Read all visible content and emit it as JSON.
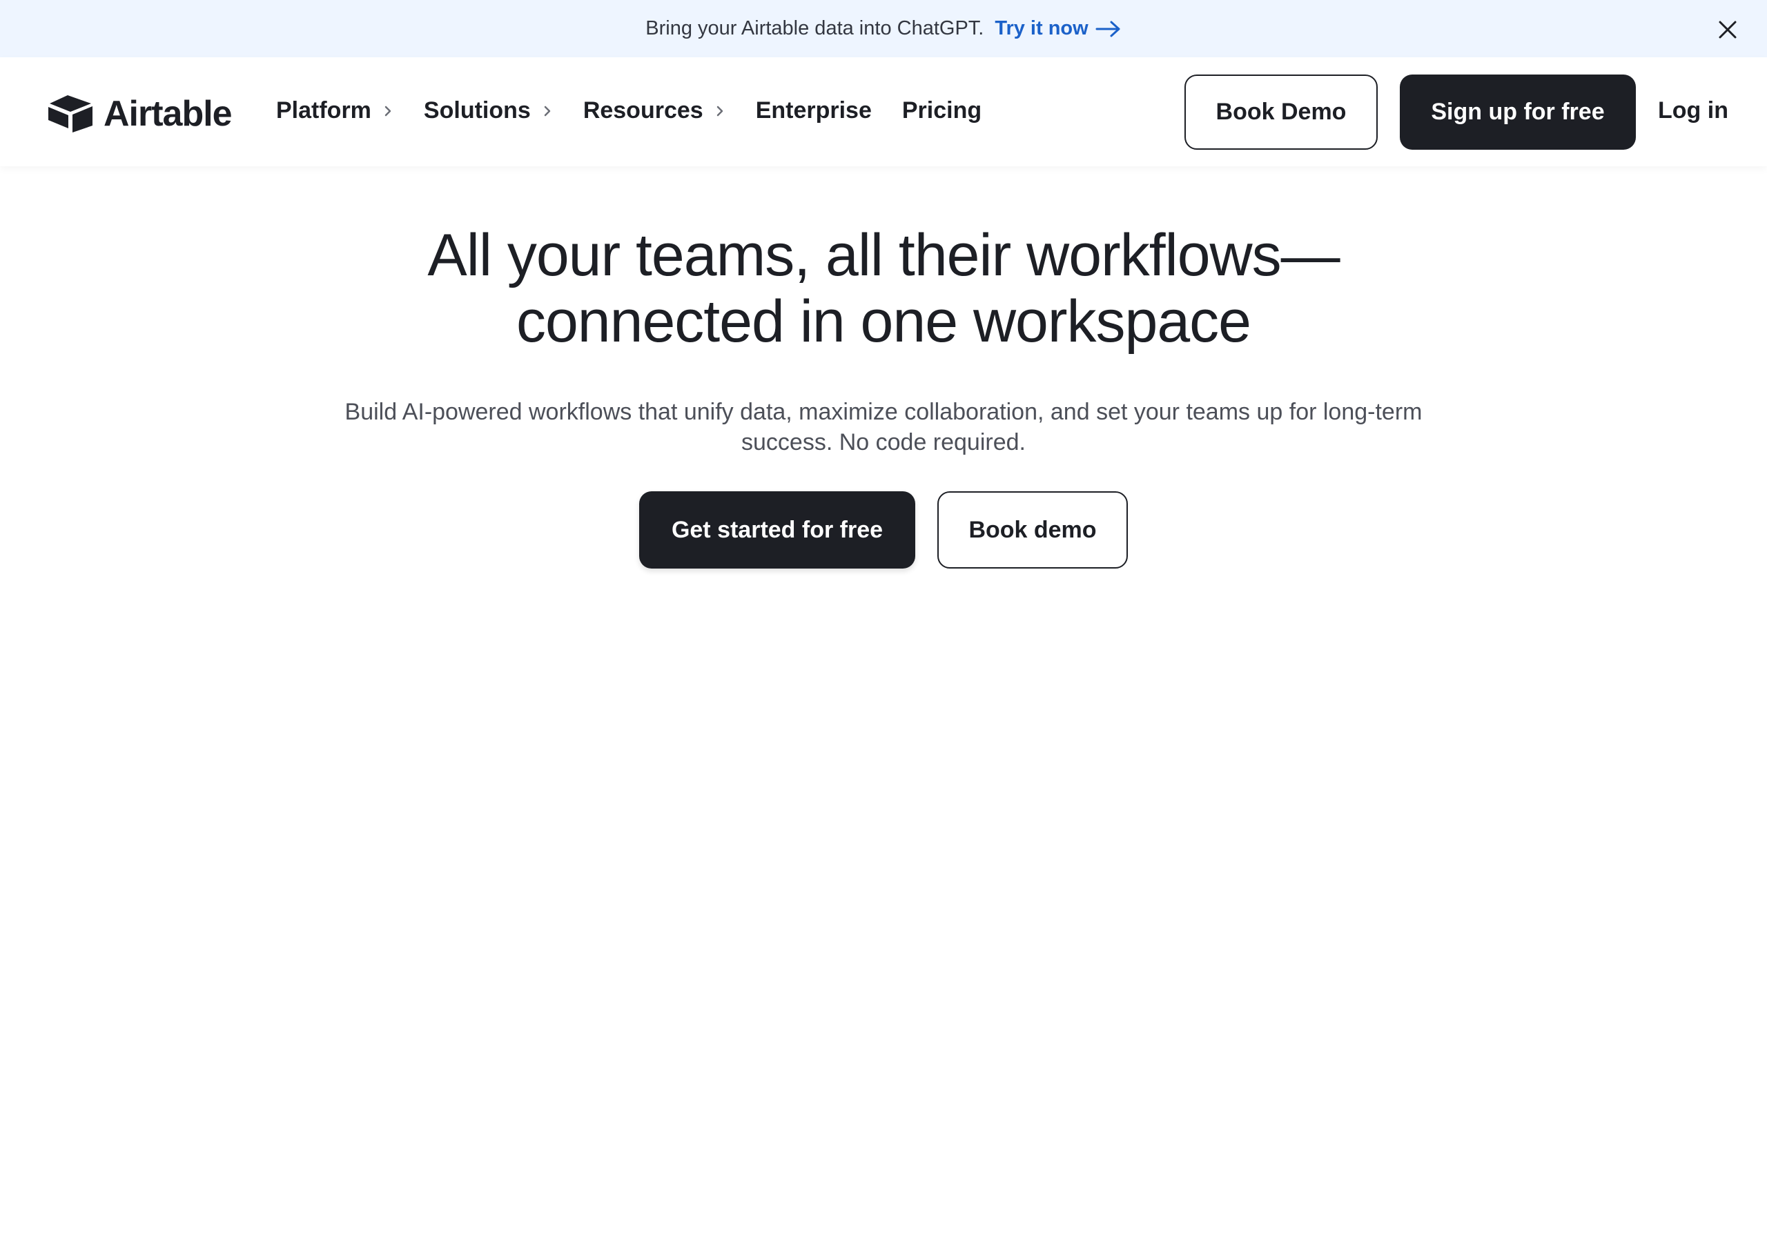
{
  "banner": {
    "text": "Bring your Airtable data into ChatGPT.",
    "link_label": "Try it now",
    "link_color": "#1b61c9",
    "background": "#eef5ff",
    "close_icon": "close-icon"
  },
  "header": {
    "logo_text": "Airtable",
    "logo_icon": "airtable-cube-icon",
    "nav": [
      {
        "label": "Platform",
        "has_submenu": true
      },
      {
        "label": "Solutions",
        "has_submenu": true
      },
      {
        "label": "Resources",
        "has_submenu": true
      },
      {
        "label": "Enterprise",
        "has_submenu": false
      },
      {
        "label": "Pricing",
        "has_submenu": false
      }
    ],
    "book_demo_label": "Book Demo",
    "signup_label": "Sign up for free",
    "login_label": "Log in"
  },
  "hero": {
    "title_line1": "All your teams, all their workflows—",
    "title_line2": "connected in one workspace",
    "subtitle_line1": "Build AI-powered workflows that unify data, maximize collaboration, and set your teams up for long-term",
    "subtitle_line2": "success. No code required.",
    "primary_cta_label": "Get started for free",
    "secondary_cta_label": "Book demo"
  },
  "colors": {
    "primary_dark": "#1d1f25",
    "body_text": "#4c4f58"
  }
}
